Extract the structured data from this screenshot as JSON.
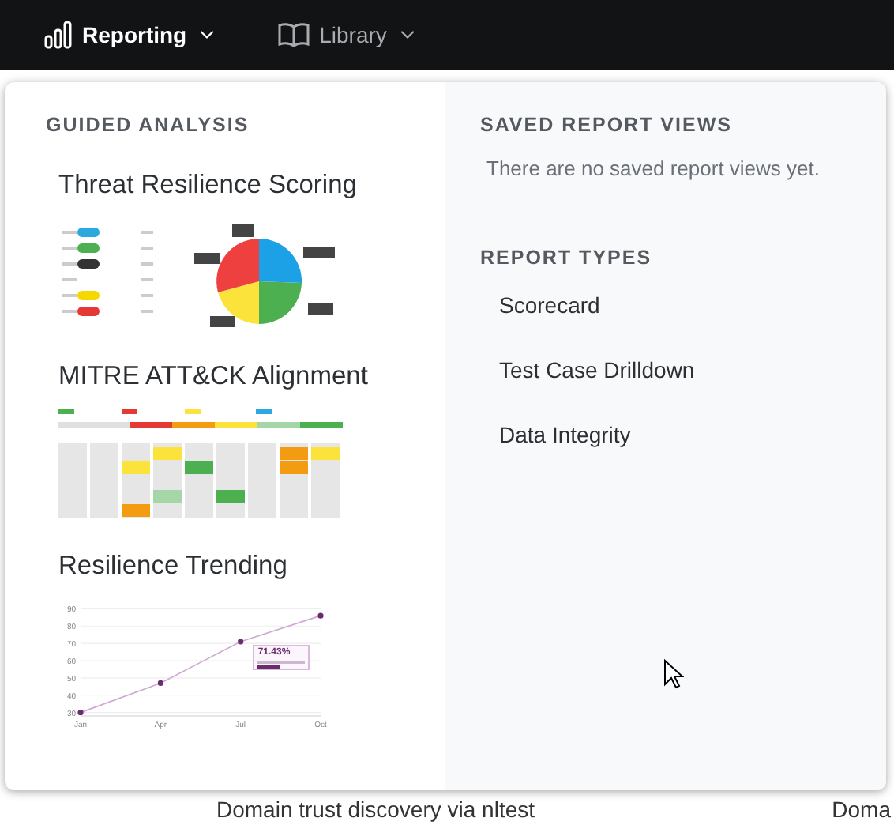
{
  "nav": [
    {
      "label": "Reporting",
      "selected": true
    },
    {
      "label": "Library",
      "selected": false
    }
  ],
  "background_rows": [
    {
      "column_1": "Domain trust discovery via nltest",
      "column_2": "Doma"
    }
  ],
  "guided_analysis": {
    "heading": "GUIDED ANALYSIS",
    "items": [
      {
        "title": "Threat Resilience Scoring",
        "kind": "pie"
      },
      {
        "title": "MITRE ATT&CK Alignment",
        "kind": "matrix"
      },
      {
        "title": "Resilience Trending",
        "kind": "line",
        "chart_data": {
          "type": "line",
          "categories": [
            "Jan",
            "Apr",
            "Jul",
            "Oct"
          ],
          "grid": true,
          "series": [
            {
              "color": "#6b2c6e",
              "marker": true,
              "values": [
                30,
                47,
                71,
                86
              ]
            }
          ],
          "ylim": [
            28,
            92
          ],
          "yticks": [
            30,
            40,
            50,
            60,
            70,
            80,
            90
          ],
          "annotations": [
            "71.43%"
          ]
        }
      }
    ]
  },
  "saved_report_views": {
    "heading": "SAVED REPORT VIEWS",
    "empty_message": "There are no saved report views yet."
  },
  "report_types": {
    "heading": "REPORT TYPES",
    "items": [
      "Scorecard",
      "Test Case Drilldown",
      "Data Integrity"
    ]
  }
}
